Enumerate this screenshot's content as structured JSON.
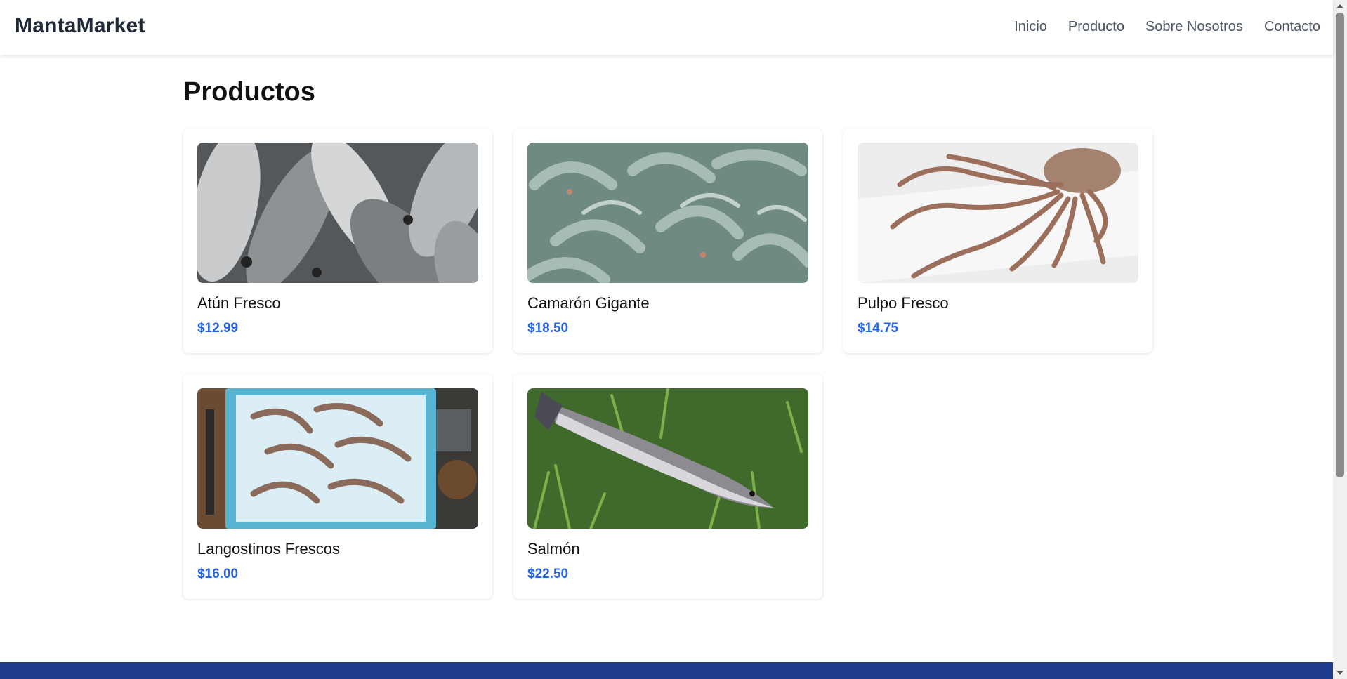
{
  "navbar": {
    "brand": "MantaMarket",
    "links": [
      "Inicio",
      "Producto",
      "Sobre Nosotros",
      "Contacto"
    ]
  },
  "main": {
    "title": "Productos",
    "products": [
      {
        "name": "Atún Fresco",
        "price": "$12.99",
        "image": "fish-image"
      },
      {
        "name": "Camarón Gigante",
        "price": "$18.50",
        "image": "shrimp-image"
      },
      {
        "name": "Pulpo Fresco",
        "price": "$14.75",
        "image": "octopus-image"
      },
      {
        "name": "Langostinos Frescos",
        "price": "$16.00",
        "image": "prawns-on-ice-image"
      },
      {
        "name": "Salmón",
        "price": "$22.50",
        "image": "salmon-on-grass-image"
      }
    ]
  },
  "colors": {
    "brand_text": "#1f2937",
    "price": "#2563eb",
    "footer": "#1e3a8a"
  }
}
